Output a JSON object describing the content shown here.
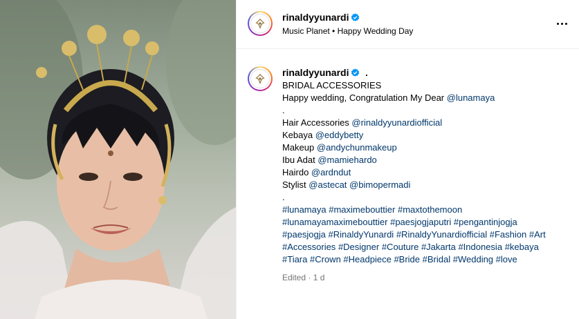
{
  "post": {
    "username": "rinaldyyunardi",
    "location": "Music Planet • Happy Wedding Day",
    "more_icon": "more-horizontal-icon",
    "verified_icon": "verified-badge-icon"
  },
  "caption": {
    "username": "rinaldyyunardi",
    "suffix": ".",
    "title": "BRIDAL ACCESSORIES",
    "congrats_text": "Happy wedding, Congratulation My Dear ",
    "congrats_mention": "@lunamaya",
    "dot1": ".",
    "credits": [
      {
        "label": "Hair Accessories ",
        "mentions": [
          "@rinaldyyunardiofficial"
        ]
      },
      {
        "label": "Kebaya ",
        "mentions": [
          "@eddybetty"
        ]
      },
      {
        "label": "Makeup ",
        "mentions": [
          "@andychunmakeup"
        ]
      },
      {
        "label": "Ibu Adat ",
        "mentions": [
          "@mamiehardo"
        ]
      },
      {
        "label": "Hairdo ",
        "mentions": [
          "@ardndut"
        ]
      },
      {
        "label": "Stylist ",
        "mentions": [
          "@astecat",
          "@bimopermadi"
        ]
      }
    ],
    "dot2": ".",
    "hashtag_lines": [
      [
        "#lunamaya",
        "#maximebouttier",
        "#maxtothemoon"
      ],
      [
        "#lunamayamaximebouttier",
        "#paesjogjaputri",
        "#pengantinjogja"
      ],
      [
        "#paesjogja",
        "#RinaldyYunardi",
        "#RinaldyYunardiofficial",
        "#Fashion",
        "#Art"
      ],
      [
        "#Accessories",
        "#Designer",
        "#Couture",
        "#Jakarta",
        "#Indonesia",
        "#kebaya"
      ],
      [
        "#Tiara",
        "#Crown",
        "#Headpiece",
        "#Bride",
        "#Bridal",
        "#Wedding",
        "#love"
      ]
    ],
    "edited": "Edited · 1 d"
  },
  "colors": {
    "link": "#00376b",
    "verified": "#0095f6",
    "muted": "#737373",
    "border": "#efefef"
  }
}
